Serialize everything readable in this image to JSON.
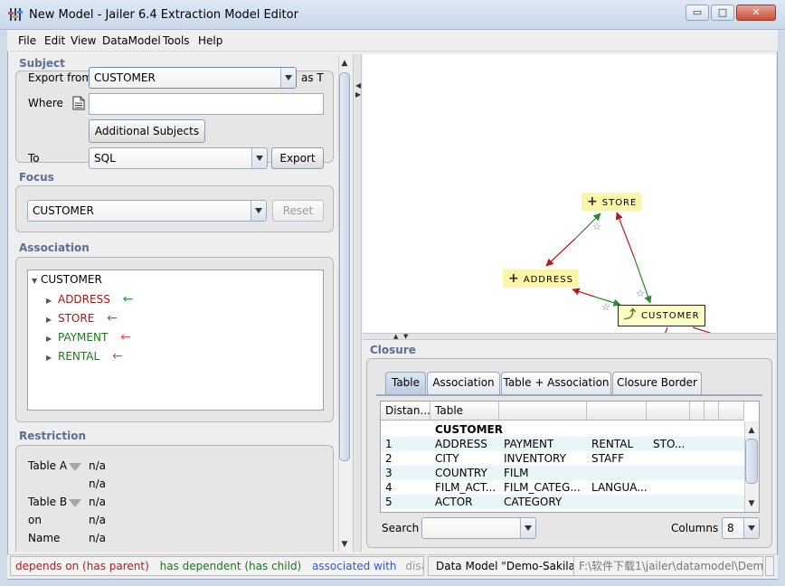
{
  "window": {
    "title": "New Model - Jailer 6.4 Extraction Model Editor",
    "min_glyph": "▭",
    "max_glyph": "□",
    "close_glyph": "✕"
  },
  "menu": [
    "File",
    "Edit",
    "View",
    "DataModel",
    "Tools",
    "Help"
  ],
  "subject": {
    "section_title": "Subject",
    "export_from_label": "Export from",
    "export_from_value": "CUSTOMER",
    "as_label": "as T",
    "where_label": "Where",
    "where_value": "",
    "additional_subjects_label": "Additional Subjects",
    "to_label": "To",
    "to_value": "SQL",
    "export_button": "Export"
  },
  "focus": {
    "section_title": "Focus",
    "value": "CUSTOMER",
    "reset_button": "Reset"
  },
  "association": {
    "section_title": "Association",
    "root": "CUSTOMER",
    "children": [
      {
        "label": "ADDRESS",
        "color": "#a11a1a",
        "arrow": "←",
        "arrow_color": "#2f9b49"
      },
      {
        "label": "STORE",
        "color": "#a11a1a",
        "arrow": "←",
        "arrow_color": "#2f9b49"
      },
      {
        "label": "PAYMENT",
        "color": "#187a18",
        "arrow": "←",
        "arrow_color": "#d55a5a"
      },
      {
        "label": "RENTAL",
        "color": "#187a18",
        "arrow": "←",
        "arrow_color": "#d55a5a"
      }
    ]
  },
  "restriction": {
    "section_title": "Restriction",
    "table_a_label": "Table A",
    "table_a_value": "n/a",
    "table_a_value2": "n/a",
    "table_b_label": "Table B",
    "table_b_value": "n/a",
    "on_label": "on",
    "on_value": "n/a",
    "name_label": "Name",
    "name_value": "n/a"
  },
  "graph": {
    "nodes": [
      "STORE",
      "ADDRESS",
      "CUSTOMER"
    ],
    "colors": {
      "to_parent": "#b41c1c",
      "to_child": "#2c8a2c",
      "node_bg": "#fbf5a9"
    }
  },
  "closure": {
    "section_title": "Closure",
    "tabs": [
      "Table",
      "Association",
      "Table + Association",
      "Closure Border"
    ],
    "active_tab": "Table",
    "columns": [
      "Distan...",
      "Table",
      "",
      "",
      "",
      "",
      "",
      ""
    ],
    "rows": [
      [
        "",
        "CUSTOMER",
        "",
        "",
        ""
      ],
      [
        "1",
        "ADDRESS",
        "PAYMENT",
        "RENTAL",
        "STO..."
      ],
      [
        "2",
        "CITY",
        "INVENTORY",
        "STAFF",
        ""
      ],
      [
        "3",
        "COUNTRY",
        "FILM",
        "",
        ""
      ],
      [
        "4",
        "FILM_ACT...",
        "FILM_CATEG...",
        "LANGUA...",
        ""
      ],
      [
        "5",
        "ACTOR",
        "CATEGORY",
        "",
        ""
      ]
    ],
    "search_label": "Search",
    "search_value": "",
    "columns_label": "Columns",
    "columns_value": "8"
  },
  "status": {
    "depends_on": "depends on (has parent)",
    "has_dependent": "has dependent (has child)",
    "associated_with": "associated with",
    "disabled": "disabled",
    "data_model": "Data Model \"Demo-Sakila\"",
    "path": "F:\\软件下载1\\jailer\\datamodel\\Dem...",
    "colors": {
      "depends_on": "#b41c1c",
      "has_dependent": "#187a18",
      "associated_with": "#2a5ad8",
      "disabled": "#9a9a9a"
    }
  }
}
